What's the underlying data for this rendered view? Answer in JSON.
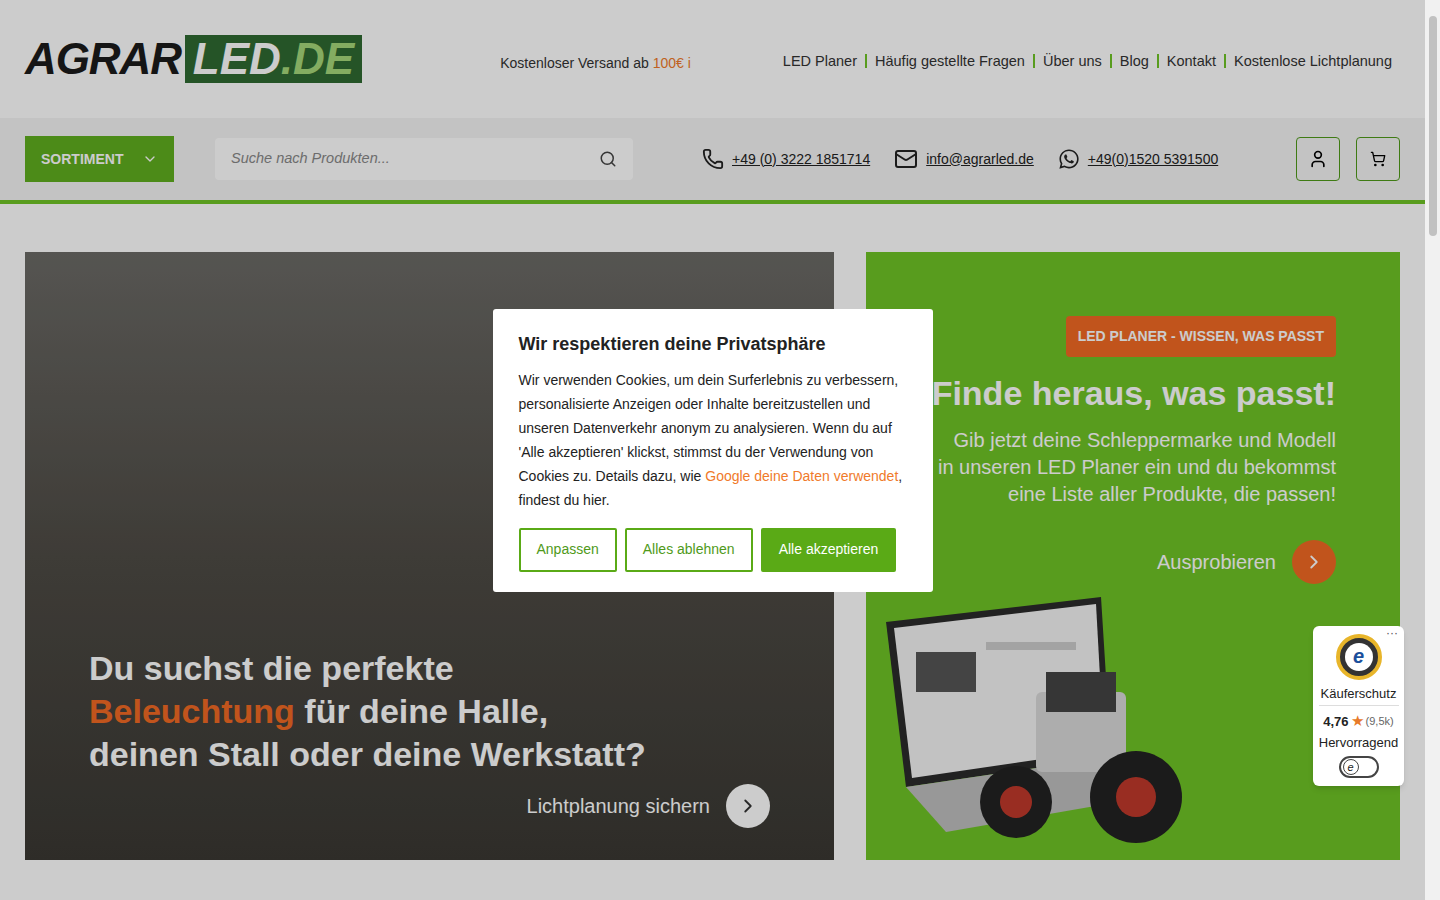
{
  "header": {
    "logo": {
      "part1": "AGRAR",
      "part2": "LED",
      "part3": ".DE"
    },
    "shipping": {
      "text": "Kostenloser Versand ab ",
      "amount": "100€ i"
    },
    "nav": [
      "LED Planer",
      "Häufig gestellte Fragen",
      "Über uns",
      "Blog",
      "Kontakt",
      "Kostenlose Lichtplanung"
    ]
  },
  "toolbar": {
    "sortiment": "SORTIMENT",
    "search_placeholder": "Suche nach Produkten...",
    "phone": "+49 (0) 3222 1851714",
    "email": "info@agrarled.de",
    "whatsapp": "+49(0)1520 5391500"
  },
  "hero_left": {
    "line1": "Du suchst die perfekte",
    "highlight": "Beleuchtung",
    "line2_rest": " für deine Halle,",
    "line3": "deinen Stall oder deine Werkstatt?",
    "cta": "Lichtplanung sichern"
  },
  "hero_right": {
    "badge": "LED PLANER - WISSEN, WAS PASST",
    "title": "Finde heraus, was passt!",
    "text": "Gib jetzt deine Schleppermarke und Modell in unseren LED Planer ein und du bekommst eine Liste aller Produkte, die passen!",
    "cta": "Ausprobieren"
  },
  "trust": {
    "more": "···",
    "seal": "e",
    "label": "Käuferschutz",
    "rating": "4,76",
    "star": "★",
    "count": "(9,5k)",
    "verdict": "Hervorragend"
  },
  "cookie": {
    "title": "Wir respektieren deine Privatsphäre",
    "text_before": "Wir verwenden Cookies, um dein Surferlebnis zu verbessern, personalisierte Anzeigen oder Inhalte bereitzustellen und unseren Datenverkehr anonym zu analysieren. Wenn du auf 'Alle akzeptieren' klickst, stimmst du der Verwendung von Cookies zu. Details dazu, wie ",
    "link": "Google deine Daten verwendet",
    "text_after": ", findest du hier.",
    "buttons": [
      {
        "label": "Anpassen",
        "kind": "outline"
      },
      {
        "label": "Alles ablehnen",
        "kind": "outline"
      },
      {
        "label": "Alle akzeptieren",
        "kind": "primary"
      }
    ]
  }
}
